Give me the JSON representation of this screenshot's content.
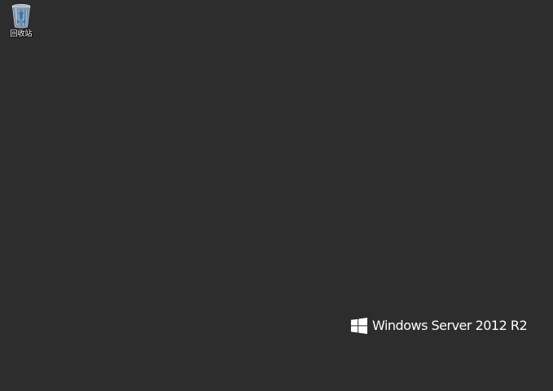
{
  "desktop": {
    "background_color": "#2d2d2d",
    "icons": [
      {
        "label": "回收站",
        "icon": "recycle-bin-icon"
      }
    ]
  },
  "branding": {
    "logo_icon": "windows-logo-icon",
    "product_name": "Windows Server 2012 R2"
  }
}
